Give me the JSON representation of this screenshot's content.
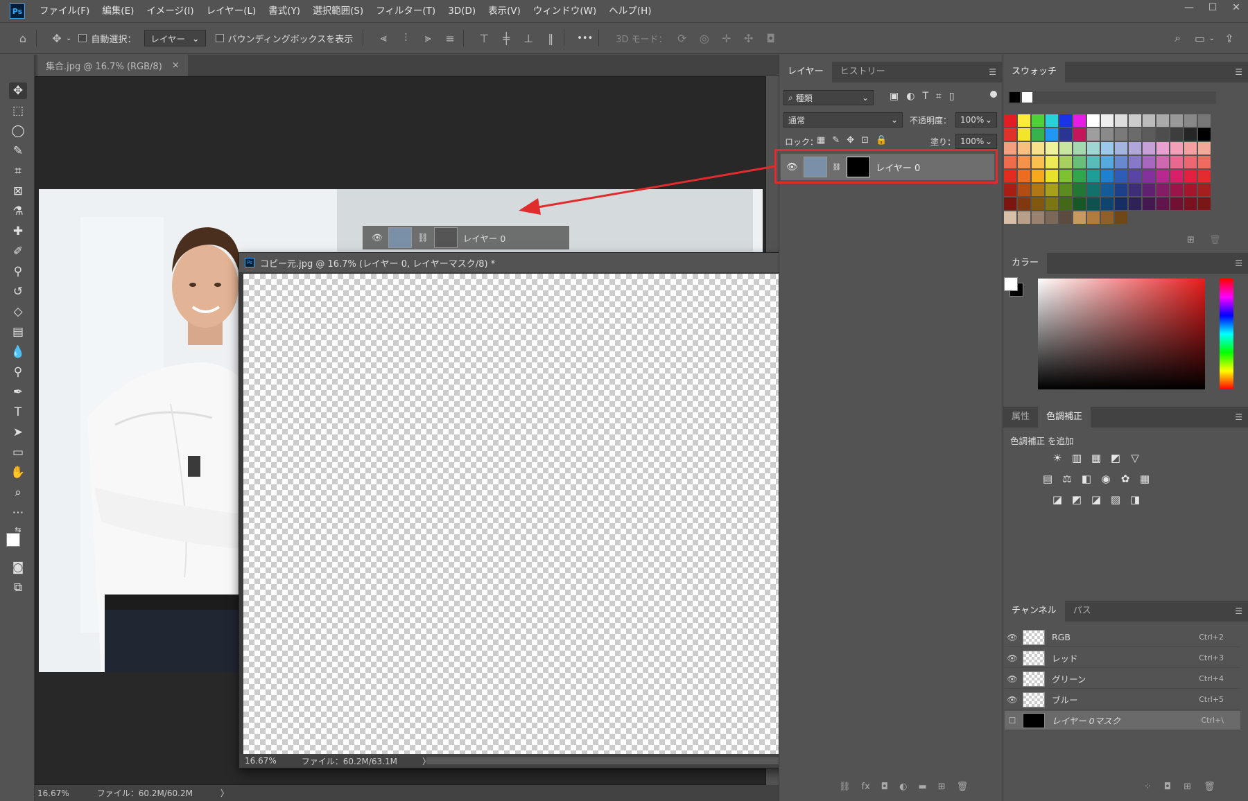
{
  "app": {
    "logo": "Ps"
  },
  "menu": [
    "ファイル(F)",
    "編集(E)",
    "イメージ(I)",
    "レイヤー(L)",
    "書式(Y)",
    "選択範囲(S)",
    "フィルター(T)",
    "3D(D)",
    "表示(V)",
    "ウィンドウ(W)",
    "ヘルプ(H)"
  ],
  "window_controls": {
    "minimize": "—",
    "maximize": "☐",
    "close": "✕"
  },
  "options": {
    "auto_select_label": "自動選択：",
    "auto_select_value": "レイヤー",
    "bbox_label": "バウンディングボックスを表示",
    "more": "•••",
    "mode3d": "3D モード："
  },
  "doc_tab": {
    "title": "集合.jpg @ 16.7% (RGB/8)",
    "close": "×"
  },
  "main_status": {
    "zoom": "16.67%",
    "file": "ファイル：60.2M/60.2M",
    "arrow": "〉"
  },
  "ghost_layer": {
    "label": "レイヤー 0"
  },
  "float_window": {
    "title": "コピー元.jpg @ 16.7% (レイヤー 0, レイヤーマスク/8) *",
    "zoom": "16.67%",
    "file": "ファイル：60.2M/63.1M",
    "arrow": "〉",
    "ctl_min": "—",
    "ctl_max": "☐",
    "ctl_close": "✕"
  },
  "layers_panel": {
    "tabs": [
      "レイヤー",
      "ヒストリー"
    ],
    "filter": "種類",
    "blend": "通常",
    "opacity_label": "不透明度：",
    "opacity": "100%",
    "lock_label": "ロック：",
    "fill_label": "塗り：",
    "fill": "100%",
    "layer_name": "レイヤー 0"
  },
  "swatches": {
    "tab": "スウォッチ",
    "colors": [
      [
        "#e51c23",
        "#ffeb3b",
        "#4cd137",
        "#27d1d8",
        "#1a33e8",
        "#e81ce8",
        "#ffffff",
        "#eeeeee",
        "#dddddd",
        "#cccccc",
        "#bbbbbb",
        "#aaaaaa",
        "#999999",
        "#888888",
        "#777777"
      ],
      [
        "#e0312b",
        "#f2e52a",
        "#37b24d",
        "#2196f3",
        "#283593",
        "#c2185b",
        "#9e9e9e",
        "#8a8a8a",
        "#7a7a7a",
        "#6b6b6b",
        "#5c5c5c",
        "#4d4d4d",
        "#3d3d3d",
        "#262626",
        "#000000"
      ],
      [
        "#f4a080",
        "#f7c080",
        "#fbe08a",
        "#eef29a",
        "#c8e6a0",
        "#a4d8b0",
        "#9fd6d4",
        "#9cc8ec",
        "#a4b4e0",
        "#b0a6da",
        "#c8a0d8",
        "#e8a0d0",
        "#f2a0b8",
        "#f4a0a0",
        "#f4a898"
      ],
      [
        "#ef6b4c",
        "#f3924c",
        "#f8c04c",
        "#eeea56",
        "#a8d060",
        "#68c078",
        "#58bcb8",
        "#58a8e0",
        "#6888d0",
        "#8878c8",
        "#a868c0",
        "#d068b0",
        "#e86890",
        "#ec6870",
        "#ef6b60"
      ],
      [
        "#e32b1e",
        "#ee6c1e",
        "#f7a81e",
        "#e8e02a",
        "#7ec232",
        "#2ea84a",
        "#1e9e98",
        "#1e80d0",
        "#2e5cb8",
        "#5a44a8",
        "#8630a0",
        "#b82890",
        "#d82068",
        "#e22040",
        "#e32b30"
      ],
      [
        "#a61e14",
        "#b04c14",
        "#b07814",
        "#a8a01a",
        "#5a8c22",
        "#207834",
        "#14706c",
        "#145c98",
        "#1e4088",
        "#3e2e78",
        "#602270",
        "#841c66",
        "#9a1648",
        "#a4162c",
        "#a61e20"
      ],
      [
        "#7a160e",
        "#82380e",
        "#82580e",
        "#7c7612",
        "#426818",
        "#165826",
        "#0e5250",
        "#0e4470",
        "#162e64",
        "#2e2258",
        "#461852",
        "#62144c",
        "#721034",
        "#7a1020",
        "#7a1616"
      ],
      [
        "#d8c0a8",
        "#b8a088",
        "#9a8270",
        "#7c6858",
        "#5c4c40",
        "#c89a60",
        "#b07c40",
        "#906028",
        "#704818"
      ]
    ]
  },
  "color_panel": {
    "tab": "カラー"
  },
  "adjust_panel": {
    "tabs": [
      "属性",
      "色調補正"
    ],
    "label": "色調補正 を追加",
    "icons_row1": [
      "☀",
      "▥",
      "▦",
      "◩",
      "▽"
    ],
    "icons_row2": [
      "▤",
      "⚖",
      "◧",
      "◉",
      "✿",
      "▦"
    ],
    "icons_row3": [
      "◪",
      "◩",
      "◪",
      "▨",
      "◨"
    ]
  },
  "channels": {
    "tabs": [
      "チャンネル",
      "パス"
    ],
    "rows": [
      {
        "name": "RGB",
        "shortcut": "Ctrl+2"
      },
      {
        "name": "レッド",
        "shortcut": "Ctrl+3"
      },
      {
        "name": "グリーン",
        "shortcut": "Ctrl+4"
      },
      {
        "name": "ブルー",
        "shortcut": "Ctrl+5"
      },
      {
        "name": "レイヤー 0マスク",
        "shortcut": "Ctrl+\\"
      }
    ]
  }
}
